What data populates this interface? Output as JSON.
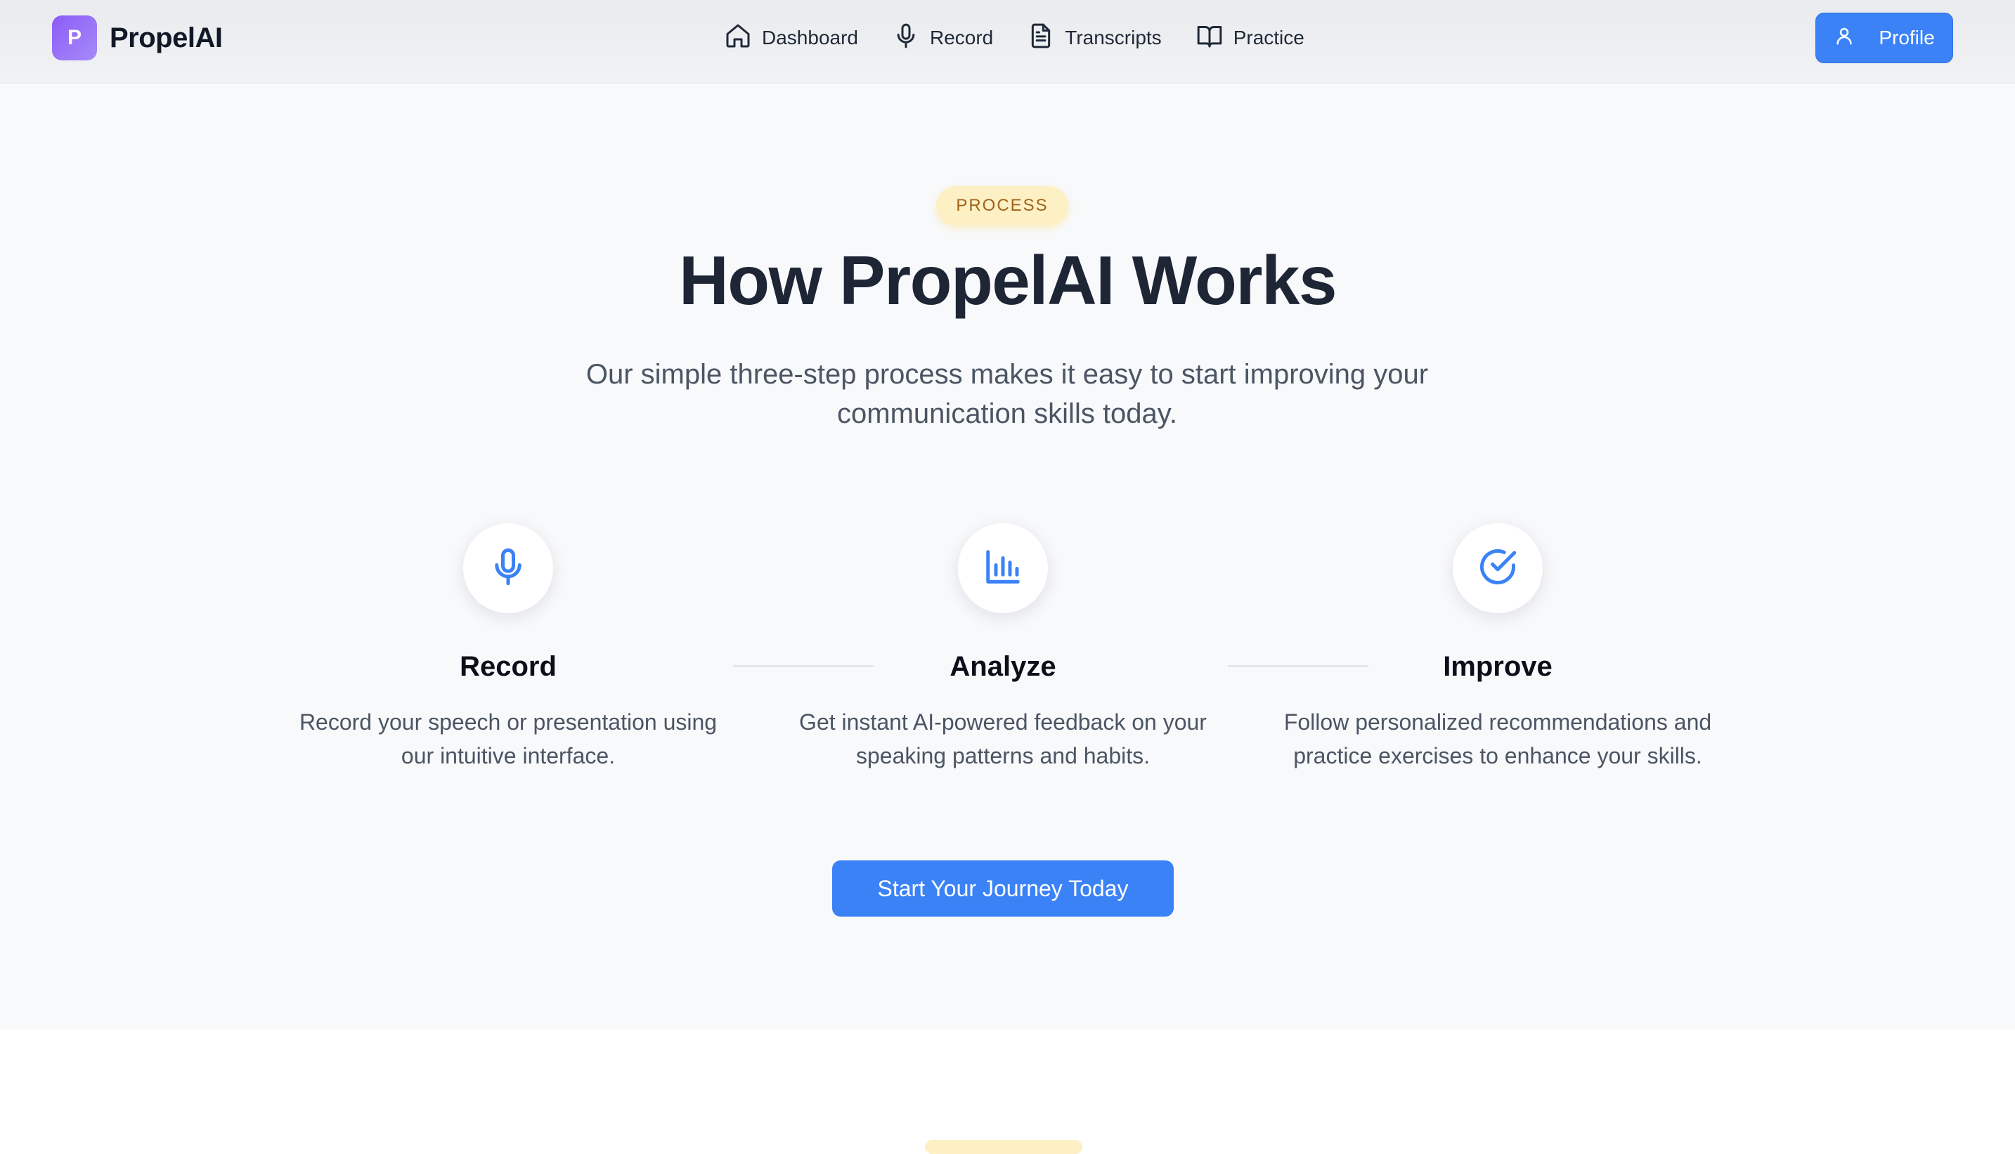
{
  "brand": {
    "logo_letter": "P",
    "name": "PropelAI",
    "logo_color": "#8b5cf6"
  },
  "nav": {
    "items": [
      {
        "label": "Dashboard",
        "icon": "home-icon"
      },
      {
        "label": "Record",
        "icon": "microphone-icon"
      },
      {
        "label": "Transcripts",
        "icon": "document-icon"
      },
      {
        "label": "Practice",
        "icon": "book-open-icon"
      }
    ],
    "profile_label": "Profile",
    "profile_icon": "user-icon"
  },
  "hero": {
    "badge": "PROCESS",
    "title": "How PropelAI Works",
    "subtitle": "Our simple three-step process makes it easy to start improving your communication skills today."
  },
  "steps": [
    {
      "title": "Record",
      "description": "Record your speech or presentation using our intuitive interface.",
      "icon": "microphone-icon"
    },
    {
      "title": "Analyze",
      "description": "Get instant AI-powered feedback on your speaking patterns and habits.",
      "icon": "bar-chart-icon"
    },
    {
      "title": "Improve",
      "description": "Follow personalized recommendations and practice exercises to enhance your skills.",
      "icon": "check-circle-icon"
    }
  ],
  "cta": {
    "label": "Start Your Journey Today"
  },
  "colors": {
    "accent": "#3b82f6",
    "badge_bg": "#fdf0c4",
    "badge_text": "#a0621a",
    "title": "#1e2535"
  }
}
